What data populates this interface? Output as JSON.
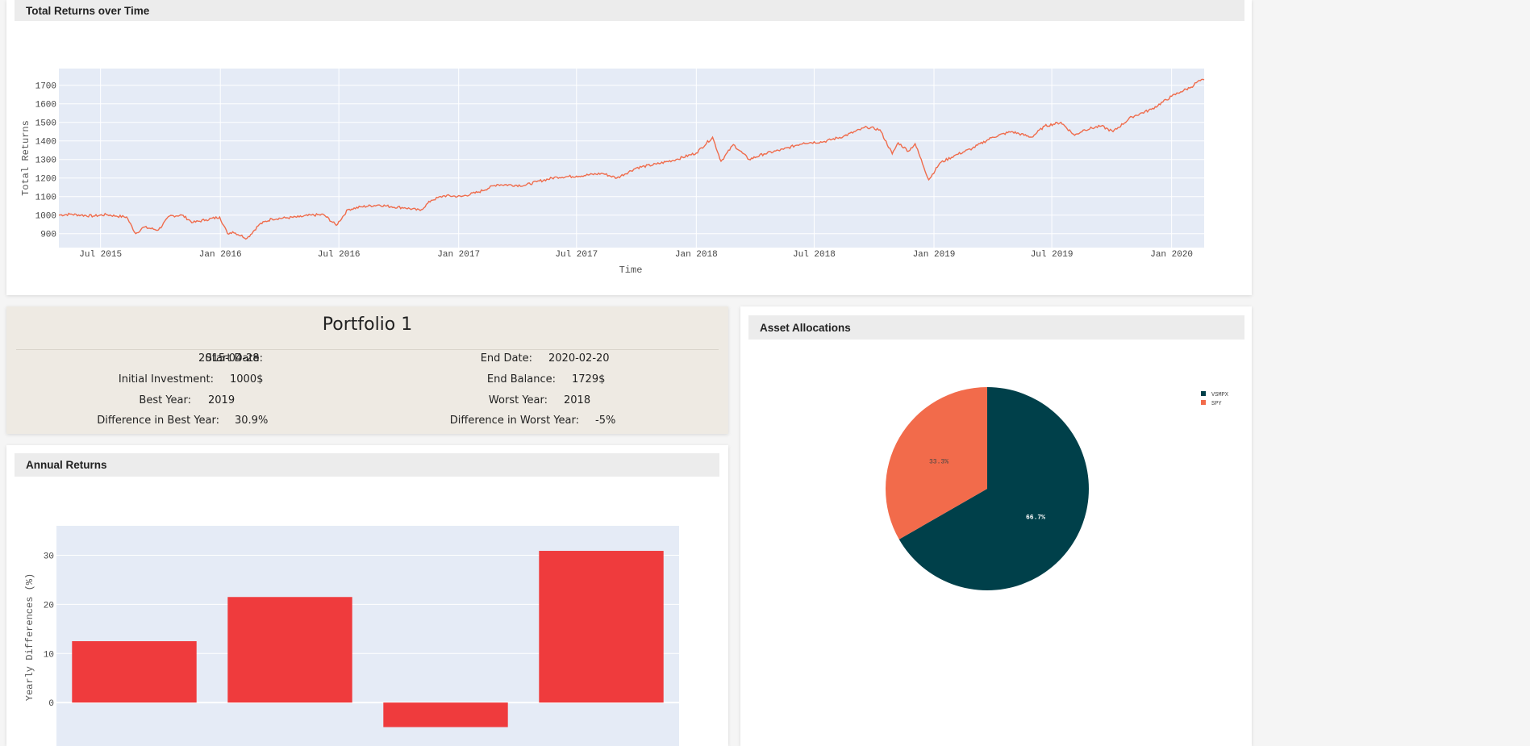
{
  "returns_panel": {
    "title": "Total Returns over Time"
  },
  "portfolio": {
    "title": "Portfolio 1",
    "left_stats": [
      {
        "label": "Start Date:",
        "value": "2015-04-28"
      },
      {
        "label": "Initial Investment:",
        "value": "1000$"
      },
      {
        "label": "Best Year:",
        "value": "2019"
      },
      {
        "label": "Difference in Best Year:",
        "value": "30.9%"
      }
    ],
    "right_stats": [
      {
        "label": "End Date:",
        "value": "2020-02-20"
      },
      {
        "label": "End Balance:",
        "value": "1729$"
      },
      {
        "label": "Worst Year:",
        "value": "2018"
      },
      {
        "label": "Difference in Worst Year:",
        "value": "-5%"
      }
    ]
  },
  "annual_panel": {
    "title": "Annual Returns"
  },
  "allocation_panel": {
    "title": "Asset Allocations"
  },
  "colors": {
    "line": "#ef6c4c",
    "plot_bg": "#e5ebf6",
    "bar": "#ef3b3d",
    "vsmpx": "#00404a",
    "spy": "#f26b4b"
  },
  "chart_data": [
    {
      "type": "line",
      "xlabel": "Time",
      "ylabel": "Total Returns",
      "x_tick_labels": [
        "Jul 2015",
        "Jan 2016",
        "Jul 2016",
        "Jan 2017",
        "Jul 2017",
        "Jan 2018",
        "Jul 2018",
        "Jan 2019",
        "Jul 2019",
        "Jan 2020"
      ],
      "y_tick_labels": [
        "900",
        "1000",
        "1100",
        "1200",
        "1300",
        "1400",
        "1500",
        "1600",
        "1700"
      ],
      "xlim": [
        "2015-04-28",
        "2020-02-20"
      ],
      "ylim": [
        825,
        1790
      ],
      "grid": true,
      "series": [
        {
          "x": [
            "2015-04-28",
            "2015-05-15",
            "2015-06-01",
            "2015-06-20",
            "2015-07-10",
            "2015-07-25",
            "2015-08-10",
            "2015-08-24",
            "2015-09-05",
            "2015-09-28",
            "2015-10-15",
            "2015-11-03",
            "2015-11-20",
            "2015-12-10",
            "2015-12-31",
            "2016-01-12",
            "2016-01-20",
            "2016-02-11",
            "2016-03-01",
            "2016-03-20",
            "2016-04-10",
            "2016-05-01",
            "2016-05-20",
            "2016-06-08",
            "2016-06-27",
            "2016-07-15",
            "2016-08-05",
            "2016-09-01",
            "2016-09-20",
            "2016-10-10",
            "2016-11-03",
            "2016-11-20",
            "2016-12-10",
            "2017-01-05",
            "2017-02-01",
            "2017-03-01",
            "2017-04-12",
            "2017-05-01",
            "2017-06-01",
            "2017-07-01",
            "2017-08-10",
            "2017-09-01",
            "2017-10-01",
            "2017-11-01",
            "2017-12-01",
            "2018-01-01",
            "2018-01-26",
            "2018-02-08",
            "2018-02-27",
            "2018-03-23",
            "2018-04-15",
            "2018-05-15",
            "2018-06-15",
            "2018-07-15",
            "2018-08-15",
            "2018-09-20",
            "2018-10-10",
            "2018-10-29",
            "2018-11-07",
            "2018-11-23",
            "2018-12-03",
            "2018-12-24",
            "2019-01-10",
            "2019-02-01",
            "2019-03-01",
            "2019-04-01",
            "2019-04-30",
            "2019-05-31",
            "2019-06-20",
            "2019-07-15",
            "2019-08-05",
            "2019-08-20",
            "2019-09-15",
            "2019-10-03",
            "2019-11-01",
            "2019-12-01",
            "2020-01-01",
            "2020-01-15",
            "2020-01-31",
            "2020-02-10",
            "2020-02-20"
          ],
          "y": [
            1000,
            1005,
            1000,
            995,
            1003,
            995,
            990,
            900,
            935,
            920,
            995,
            1000,
            960,
            975,
            990,
            900,
            910,
            875,
            950,
            980,
            985,
            990,
            1000,
            1002,
            945,
            1030,
            1045,
            1055,
            1045,
            1040,
            1025,
            1080,
            1105,
            1100,
            1125,
            1165,
            1160,
            1180,
            1205,
            1210,
            1225,
            1200,
            1255,
            1275,
            1300,
            1335,
            1420,
            1290,
            1380,
            1300,
            1330,
            1355,
            1390,
            1395,
            1425,
            1475,
            1460,
            1330,
            1390,
            1345,
            1385,
            1190,
            1280,
            1320,
            1360,
            1420,
            1450,
            1420,
            1480,
            1500,
            1430,
            1460,
            1480,
            1450,
            1530,
            1570,
            1640,
            1665,
            1690,
            1720,
            1729
          ]
        }
      ]
    },
    {
      "type": "bar",
      "ylabel": "Yearly Differences (%)",
      "y_tick_labels": [
        "30",
        "20",
        "10",
        "0"
      ],
      "ylim": [
        -10,
        36
      ],
      "grid": true,
      "values": [
        12.5,
        21.5,
        -5,
        30.9
      ]
    },
    {
      "type": "pie",
      "legend_position": "top-right",
      "slices": [
        {
          "label": "VSMPX",
          "value": 66.7,
          "text": "66.7%"
        },
        {
          "label": "SPY",
          "value": 33.3,
          "text": "33.3%"
        }
      ]
    }
  ]
}
